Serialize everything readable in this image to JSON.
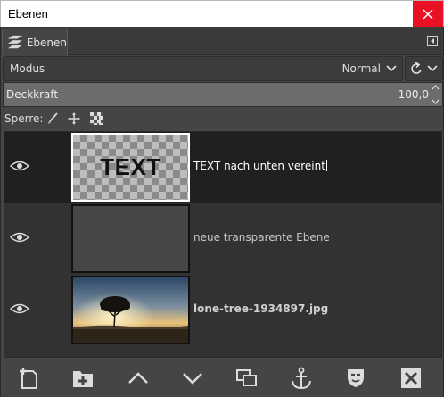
{
  "window": {
    "title": "Ebenen"
  },
  "tab": {
    "label": "Ebenen"
  },
  "mode": {
    "label": "Modus",
    "value": "Normal"
  },
  "opacity": {
    "label": "Deckkraft",
    "value": "100,0"
  },
  "lock": {
    "label": "Sperre:",
    "icons": [
      "paintbrush-icon",
      "move-icon",
      "alpha-checker-icon"
    ]
  },
  "layers": [
    {
      "name": "TEXT nach unten vereint",
      "thumb_text": "TEXT",
      "selected": true,
      "visible": true
    },
    {
      "name": "neue transparente Ebene",
      "selected": false,
      "visible": true
    },
    {
      "name": "lone-tree-1934897.jpg",
      "selected": false,
      "visible": true
    }
  ],
  "toolbar": [
    "new-layer-icon",
    "new-group-icon",
    "raise-layer-icon",
    "lower-layer-icon",
    "duplicate-layer-icon",
    "anchor-layer-icon",
    "layer-mask-icon",
    "delete-layer-icon"
  ],
  "colors": {
    "panel": "#454545",
    "list": "#323232",
    "selected_row": "#202020",
    "close": "#e81123"
  }
}
